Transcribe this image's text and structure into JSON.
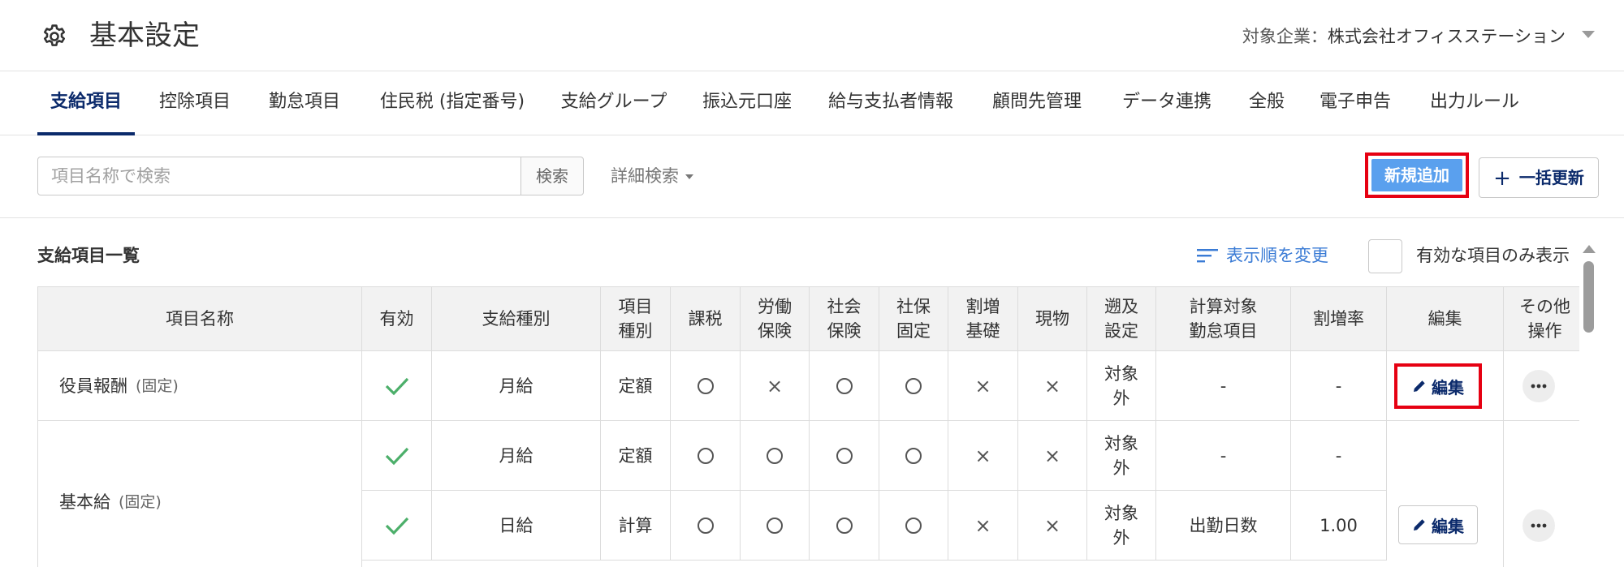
{
  "header": {
    "title": "基本設定",
    "company_label": "対象企業：",
    "company_name": "株式会社オフィスステーション"
  },
  "tabs": [
    {
      "label": "支給項目",
      "active": true
    },
    {
      "label": "控除項目"
    },
    {
      "label": "勤怠項目"
    },
    {
      "label": "住民税 (指定番号)"
    },
    {
      "label": "支給グループ"
    },
    {
      "label": "振込元口座"
    },
    {
      "label": "給与支払者情報"
    },
    {
      "label": "顧問先管理"
    },
    {
      "label": "データ連携"
    },
    {
      "label": "全般"
    },
    {
      "label": "電子申告"
    },
    {
      "label": "出力ルール"
    }
  ],
  "toolbar": {
    "search_placeholder": "項目名称で検索",
    "search_button": "検索",
    "advanced_search": "詳細検索",
    "new_button": "新規追加",
    "bulk_update_button": "一括更新"
  },
  "list": {
    "title": "支給項目一覧",
    "sort_link": "表示順を変更",
    "only_valid_label": "有効な項目のみ表示"
  },
  "table": {
    "headers": [
      "項目名称",
      "有効",
      "支給種別",
      "項目\n種別",
      "課税",
      "労働\n保険",
      "社会\n保険",
      "社保\n固定",
      "割増\n基礎",
      "現物",
      "遡及\n設定",
      "計算対象\n勤怠項目",
      "割増率",
      "編集",
      "その他\n操作"
    ],
    "rows": [
      {
        "name": "役員報酬",
        "note": "(固定)",
        "valid": true,
        "pay_type": "月給",
        "item_type": "定額",
        "tax": "○",
        "labor": "×",
        "social": "○",
        "social_fixed": "○",
        "premium_base": "×",
        "in_kind": "×",
        "retro": "対象\n外",
        "calc_target": "-",
        "rate": "-",
        "edit": "編集"
      },
      {
        "name": "基本給",
        "note": "(固定)",
        "valid": true,
        "pay_type": "月給",
        "item_type": "定額",
        "tax": "○",
        "labor": "○",
        "social": "○",
        "social_fixed": "○",
        "premium_base": "×",
        "in_kind": "×",
        "retro": "対象\n外",
        "calc_target": "-",
        "rate": "-",
        "edit": "編集"
      },
      {
        "valid": true,
        "pay_type": "日給",
        "item_type": "計算",
        "tax": "○",
        "labor": "○",
        "social": "○",
        "social_fixed": "○",
        "premium_base": "×",
        "in_kind": "×",
        "retro": "対象\n外",
        "calc_target": "出勤日数",
        "rate": "1.00"
      }
    ]
  },
  "colors": {
    "accent_navy": "#0b2a6b",
    "primary_button": "#5aa0ee",
    "highlight_red": "#e60012",
    "check_green": "#4caf6a",
    "link_blue": "#3a7bd5"
  },
  "icons": {
    "settings": "gear-icon",
    "valid": "check-icon",
    "edit": "pencil-icon",
    "more": "more-dots-icon",
    "sort": "sort-lines-icon"
  }
}
